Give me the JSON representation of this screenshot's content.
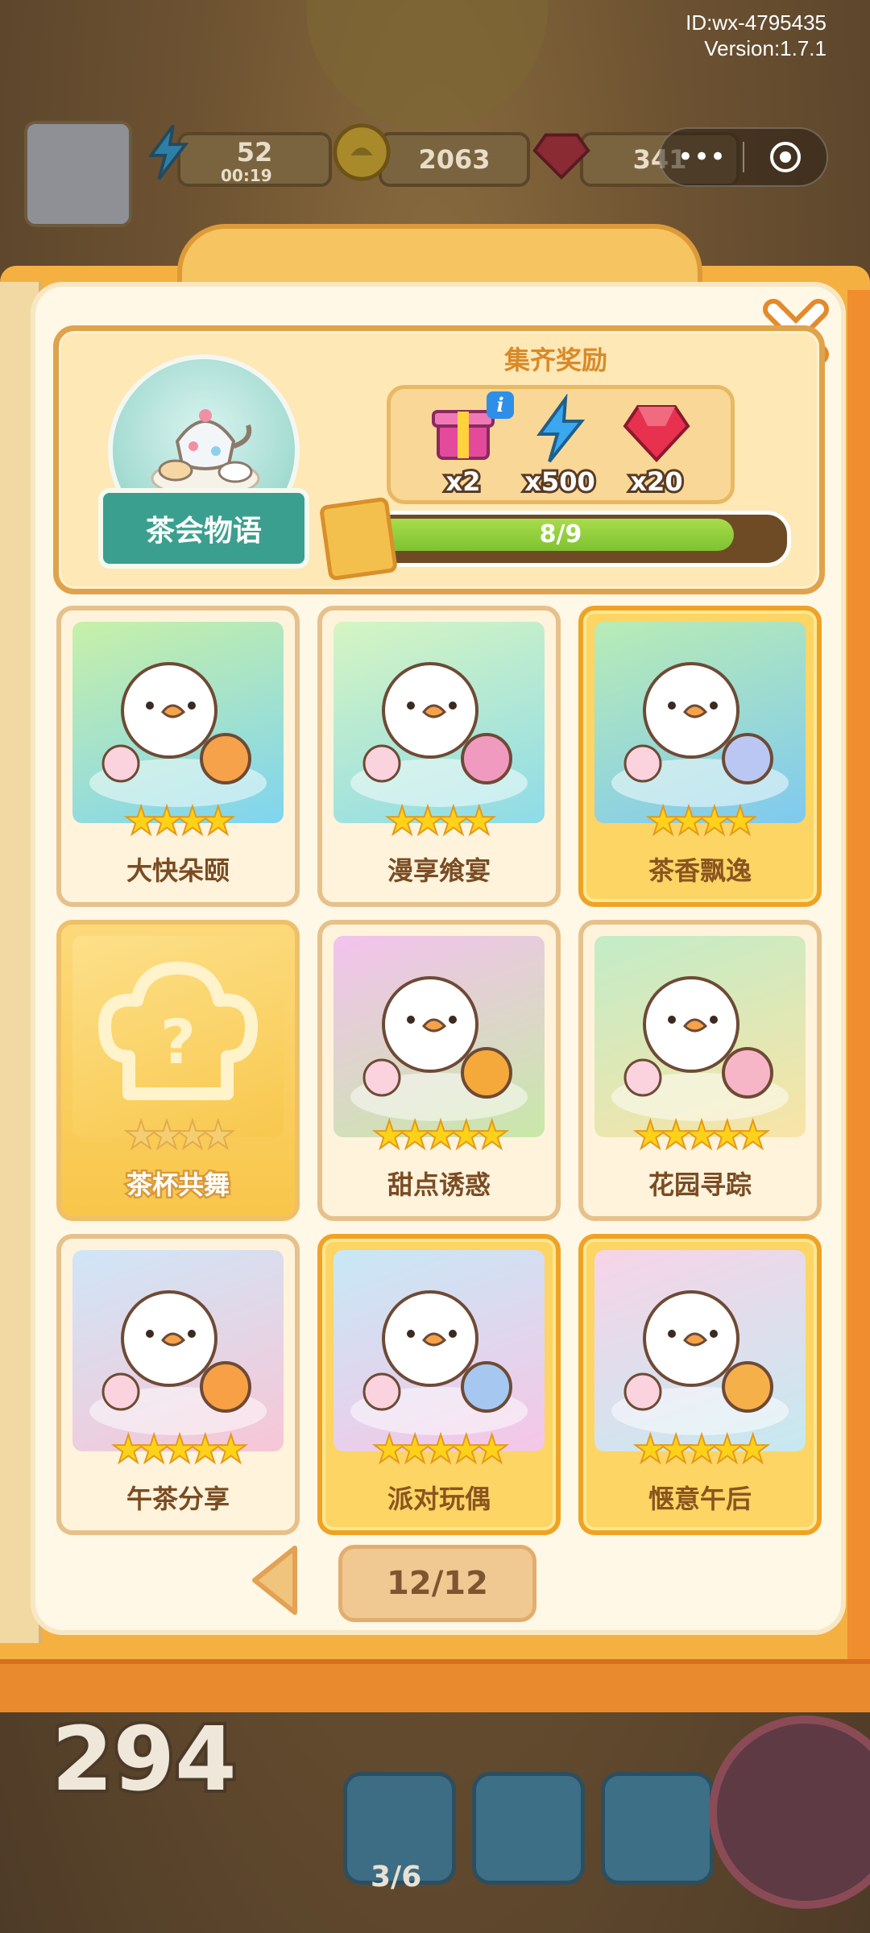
{
  "meta": {
    "id": "ID:wx-4795435",
    "version": "Version:1.7.1"
  },
  "resources": {
    "energy": {
      "value": "52",
      "timer": "00:19"
    },
    "coins": {
      "value": "2063"
    },
    "gems": {
      "value": "341"
    }
  },
  "capsule": {
    "more_glyph": "•••"
  },
  "background": {
    "big_number": "294",
    "bottom_progress": "3/6"
  },
  "album": {
    "name": "茶会物语",
    "reward_title": "集齐奖励",
    "rewards": [
      {
        "icon": "gift-box-icon",
        "qty": "x2",
        "color": "#e44a9c"
      },
      {
        "icon": "energy-bolt-icon",
        "qty": "x500",
        "color": "#3aa7ef"
      },
      {
        "icon": "ruby-gem-icon",
        "qty": "x20",
        "color": "#e8304f"
      }
    ],
    "info_glyph": "i",
    "progress": {
      "text": "8/9",
      "fraction": 0.889
    }
  },
  "cards": [
    {
      "name": "大快朵颐",
      "stars": "★★★★",
      "style": "normal",
      "bg": [
        "#c8f0a8",
        "#7fd4f0"
      ],
      "accent": "#f6a24a"
    },
    {
      "name": "漫享飨宴",
      "stars": "★★★★",
      "style": "normal",
      "bg": [
        "#d6f5c2",
        "#8edbe8"
      ],
      "accent": "#f19ac0"
    },
    {
      "name": "茶香飘逸",
      "stars": "★★★★",
      "style": "gold",
      "bg": [
        "#b9ecb5",
        "#7fc9f0"
      ],
      "accent": "#b9c7f2"
    },
    {
      "name": "茶杯共舞",
      "stars": "★★★★",
      "style": "unknown",
      "bg": [
        "#fde08a",
        "#f8c84e"
      ],
      "accent": "#ffffff"
    },
    {
      "name": "甜点诱惑",
      "stars": "★★★★★",
      "style": "normal",
      "bg": [
        "#f3c2ee",
        "#c8e8a8"
      ],
      "accent": "#f4a93a"
    },
    {
      "name": "花园寻踪",
      "stars": "★★★★★",
      "style": "normal",
      "bg": [
        "#c2ecc8",
        "#f9e4a6"
      ],
      "accent": "#f7b6c8"
    },
    {
      "name": "午茶分享",
      "stars": "★★★★★",
      "style": "normal",
      "bg": [
        "#cfe6f7",
        "#f7c6d6"
      ],
      "accent": "#f8a046"
    },
    {
      "name": "派对玩偶",
      "stars": "★★★★★",
      "style": "gold",
      "bg": [
        "#c7e8f6",
        "#f6c6e6"
      ],
      "accent": "#a5c7f0"
    },
    {
      "name": "惬意午后",
      "stars": "★★★★★",
      "style": "gold",
      "bg": [
        "#f7d4e8",
        "#c6e9f0"
      ],
      "accent": "#f6b04a"
    }
  ],
  "pagination": {
    "label": "12/12"
  },
  "icons": {
    "close": "close-icon",
    "prev": "chevron-left-icon"
  }
}
